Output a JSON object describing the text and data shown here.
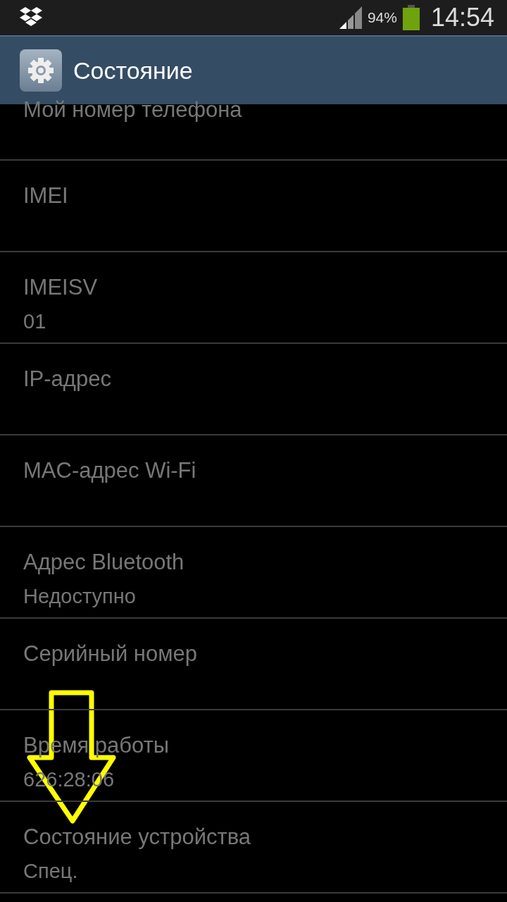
{
  "status_bar": {
    "battery_percent": "94%",
    "time": "14:54"
  },
  "action_bar": {
    "title": "Состояние"
  },
  "items": [
    {
      "title": "Мой номер телефона"
    },
    {
      "title": "IMEI"
    },
    {
      "title": "IMEISV",
      "value": "01"
    },
    {
      "title": "IP-адрес"
    },
    {
      "title": "MAC-адрес Wi-Fi"
    },
    {
      "title": "Адрес Bluetooth",
      "value": "Недоступно"
    },
    {
      "title": "Серийный номер"
    },
    {
      "title": "Время работы",
      "value": "626:28:06"
    },
    {
      "title": "Состояние устройства",
      "value": "Спец."
    }
  ]
}
